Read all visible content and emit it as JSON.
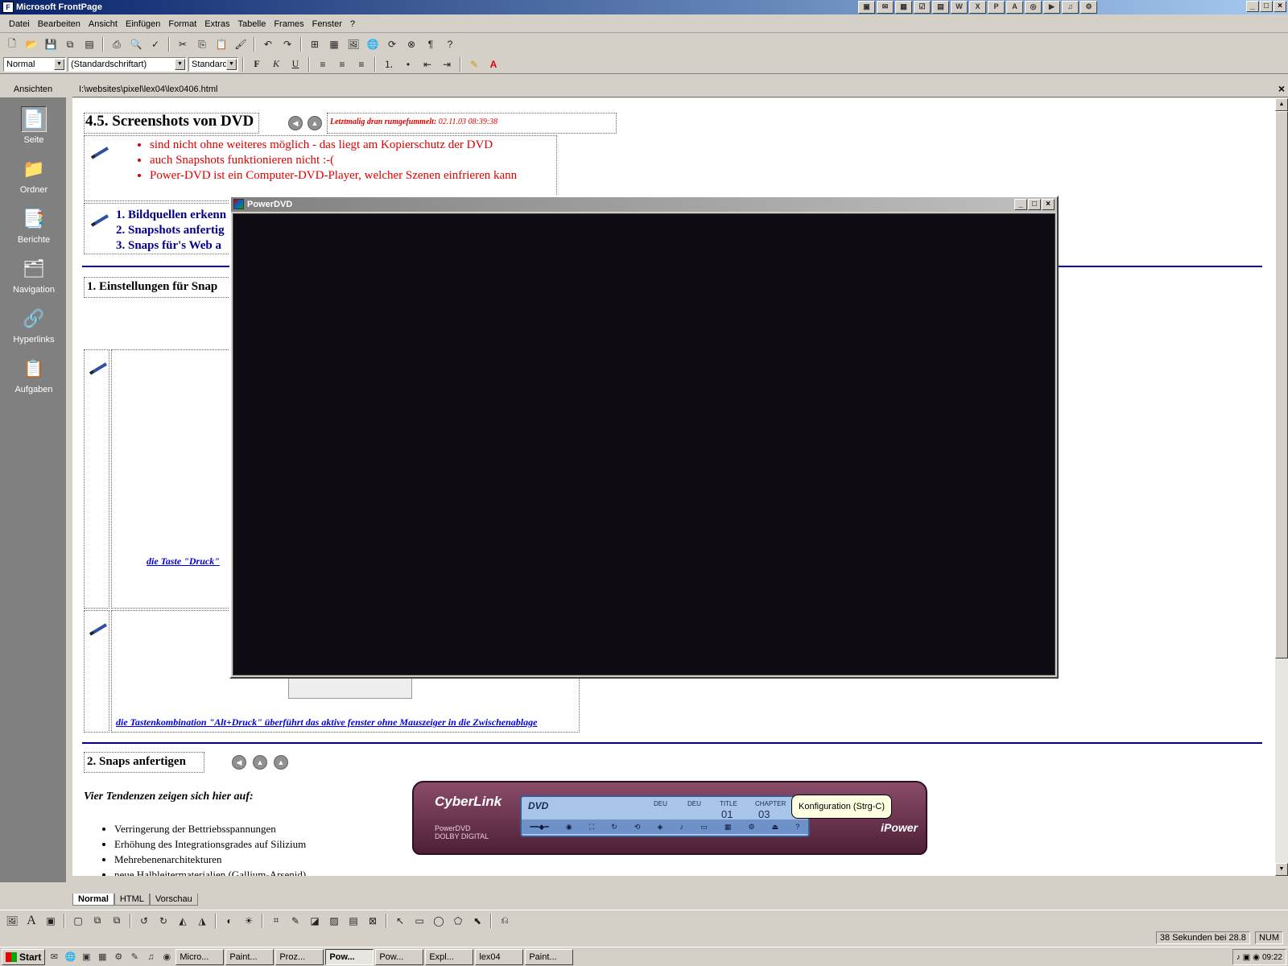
{
  "titlebar": {
    "title": "Microsoft FrontPage"
  },
  "menu": [
    "Datei",
    "Bearbeiten",
    "Ansicht",
    "Einfügen",
    "Format",
    "Extras",
    "Tabelle",
    "Frames",
    "Fenster",
    "?"
  ],
  "format_toolbar": {
    "style": "Normal",
    "font": "(Standardschriftart)",
    "size": "Standard",
    "bold": "F",
    "italic": "K",
    "underline": "U"
  },
  "views": {
    "header": "Ansichten",
    "items": [
      {
        "label": "Seite",
        "icon": "page-icon"
      },
      {
        "label": "Ordner",
        "icon": "folder-icon"
      },
      {
        "label": "Berichte",
        "icon": "reports-icon"
      },
      {
        "label": "Navigation",
        "icon": "navigation-icon"
      },
      {
        "label": "Hyperlinks",
        "icon": "hyperlinks-icon"
      },
      {
        "label": "Aufgaben",
        "icon": "tasks-icon"
      }
    ]
  },
  "document": {
    "path": "I:\\websites\\pixel\\lex04\\lex0406.html",
    "heading": "4.5. Screenshots von DVD",
    "timestamp_label": "Letztmalig dran rumgefummelt:",
    "timestamp_value": "02.11.03 08:39:38",
    "red_bullets": [
      "sind nicht ohne weiteres möglich - das liegt am Kopierschutz der DVD",
      "auch  Snapshots funktionieren nicht :-(",
      "Power-DVD ist ein Computer-DVD-Player, welcher Szenen einfrieren kann"
    ],
    "numbered": [
      "1. Bildquellen erkenn",
      "2. Snapshots anfertig",
      "3. Snaps für's Web a"
    ],
    "section1": "1. Einstellungen für Snap",
    "caption1": "die Taste \"Druck\"",
    "caption2": "die Tastenkombination \"Alt+Druck\" überführt das aktive fenster ohne Mauszeiger in die Zwischenablage",
    "section2": "2. Snaps anfertigen",
    "tendencies_title": "Vier Tendenzen zeigen sich hier auf:",
    "tendencies": [
      "Verringerung der Bettriebsspannungen",
      "Erhöhung des Integrationsgrades auf Silizium",
      "Mehrebenenarchitekturen",
      "neue Halbleitermaterialien (Gallium-Arsenid)"
    ]
  },
  "powerdvd": {
    "title": "PowerDVD"
  },
  "cyberlink": {
    "brand": "CyberLink",
    "product": "PowerDVD",
    "dolby": "DOLBY DIGITAL",
    "lcd_audio": "DEU",
    "lcd_sub": "DEU",
    "title_label": "TITLE",
    "title_value": "01",
    "chapter_label": "CHAPTER",
    "chapter_value": "03",
    "ipower": "iPower",
    "tooltip": "Konfiguration (Strg-C)"
  },
  "viewtabs": [
    "Normal",
    "HTML",
    "Vorschau"
  ],
  "status": {
    "download": "38 Sekunden bei 28.8",
    "num": "NUM"
  },
  "taskbar": {
    "start": "Start",
    "tasks": [
      "Micro...",
      "Paint...",
      "Proz...",
      "Pow...",
      "Pow...",
      "Expl...",
      "lex04",
      "Paint..."
    ],
    "clock": "09:22"
  }
}
